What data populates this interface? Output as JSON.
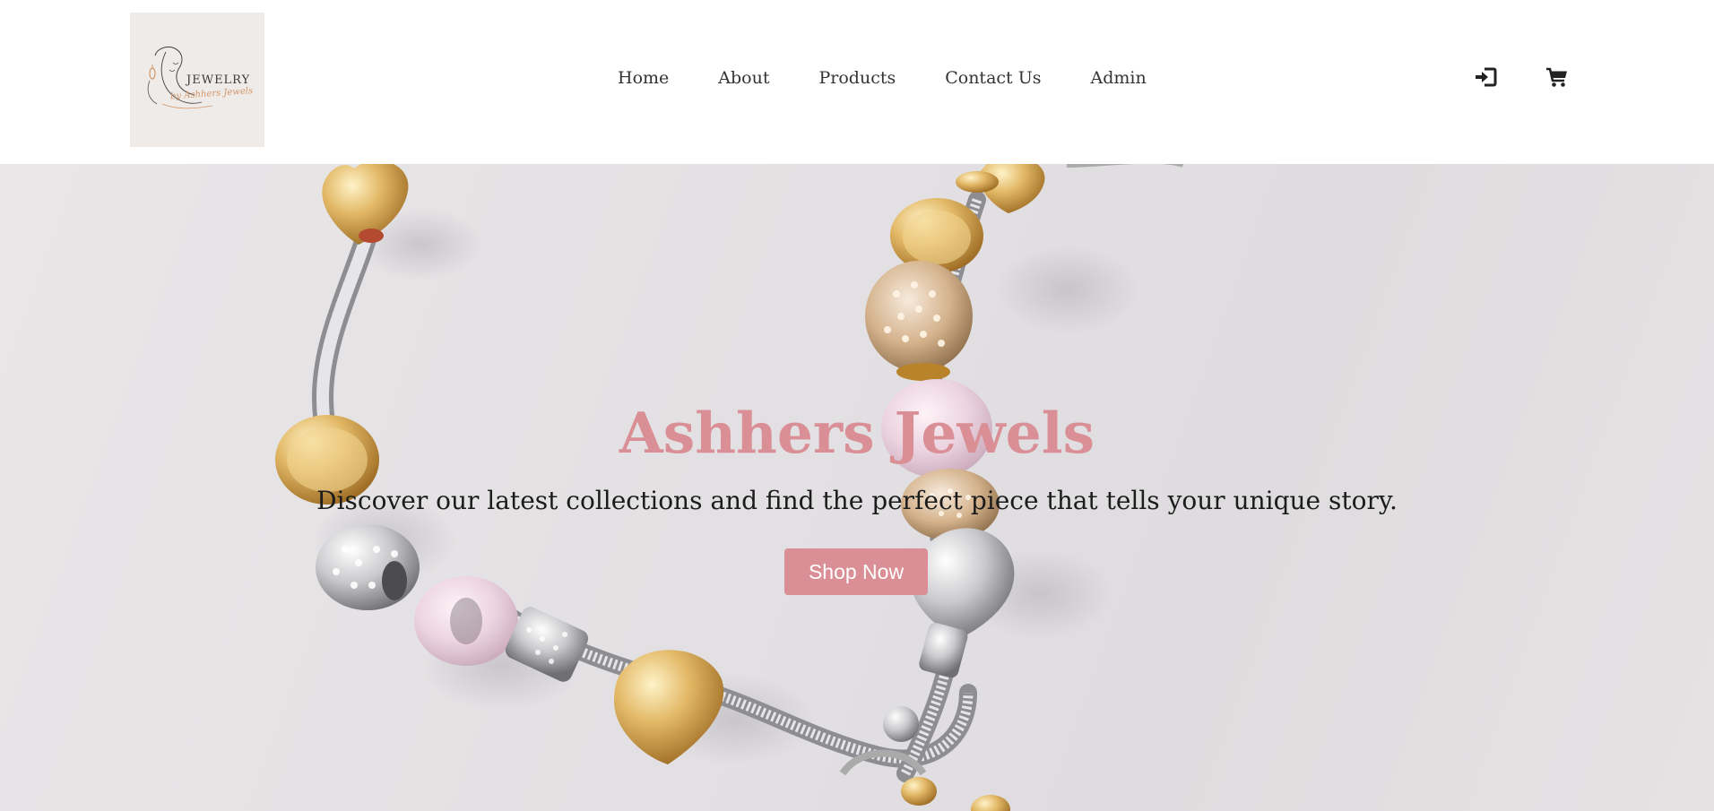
{
  "brand": {
    "logo_word": "JEWELRY",
    "logo_script": "by Ashhers Jewels",
    "accent_color": "#d98f95"
  },
  "nav": {
    "items": [
      {
        "label": "Home"
      },
      {
        "label": "About"
      },
      {
        "label": "Products"
      },
      {
        "label": "Contact Us"
      },
      {
        "label": "Admin"
      }
    ]
  },
  "header_icons": {
    "login": "sign-in-icon",
    "cart": "shopping-cart-icon"
  },
  "hero": {
    "title": "Ashhers Jewels",
    "subtitle": "Discover our latest collections and find the perfect piece that tells your unique story.",
    "cta_label": "Shop Now"
  }
}
